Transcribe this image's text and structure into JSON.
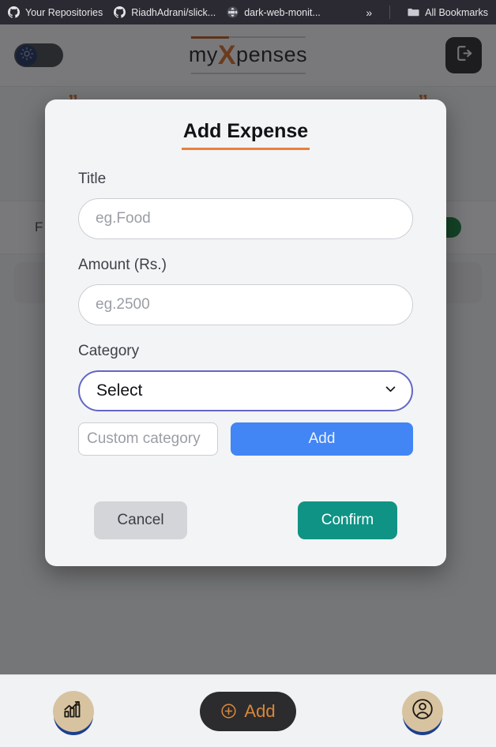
{
  "browser": {
    "bookmarks": [
      {
        "label": "Your Repositories",
        "icon": "github-icon"
      },
      {
        "label": "RiadhAdrani/slick...",
        "icon": "github-icon"
      },
      {
        "label": "dark-web-monit...",
        "icon": "globe-icon"
      }
    ],
    "overflow_label": "»",
    "all_bookmarks_label": "All Bookmarks",
    "all_bookmarks_icon": "folder-icon"
  },
  "header": {
    "theme_toggle": {
      "name": "theme-toggle",
      "state": "off",
      "icon": "sun-icon"
    },
    "brand": {
      "prefix": "my",
      "accent": "X",
      "suffix": "penses",
      "accent_color": "#d9661f"
    },
    "logout": {
      "icon": "logout-icon",
      "label": "Logout"
    }
  },
  "background": {
    "quote_mark": "”",
    "filter_text": "F",
    "toggle_color": "#0b7a35"
  },
  "modal": {
    "title": "Add Expense",
    "accent_color": "#e8813a",
    "fields": {
      "title": {
        "label": "Title",
        "value": "",
        "placeholder": "eg.Food"
      },
      "amount": {
        "label": "Amount (Rs.)",
        "value": "",
        "placeholder": "eg.2500"
      },
      "category": {
        "label": "Category",
        "selected": "Select",
        "options": [
          "Select"
        ]
      },
      "custom_category": {
        "value": "",
        "placeholder": "Custom category"
      }
    },
    "buttons": {
      "add": "Add",
      "cancel": "Cancel",
      "confirm": "Confirm"
    },
    "colors": {
      "add": "#4285f4",
      "cancel": "#d3d5d9",
      "confirm": "#0f9384",
      "select_border": "#6366c4"
    }
  },
  "bottom_nav": {
    "stats": {
      "label": "Statistics",
      "icon": "chart-growth-icon"
    },
    "add": {
      "label": "Add",
      "icon": "plus-circle-icon"
    },
    "profile": {
      "label": "Profile",
      "icon": "user-circle-icon"
    }
  }
}
